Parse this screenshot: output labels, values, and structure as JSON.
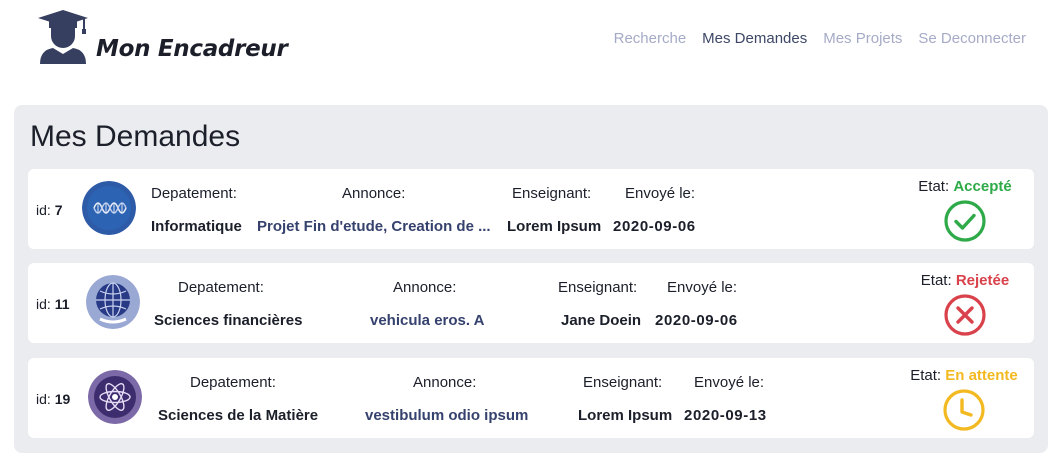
{
  "brand": {
    "name": "Mon Encadreur",
    "icon": "graduate-icon"
  },
  "nav": {
    "items": [
      {
        "label": "Recherche",
        "active": false
      },
      {
        "label": "Mes Demandes",
        "active": true
      },
      {
        "label": "Mes Projets",
        "active": false
      },
      {
        "label": "Se Deconnecter",
        "active": false
      }
    ]
  },
  "page": {
    "title": "Mes Demandes"
  },
  "labels": {
    "id": "id:",
    "departement": "Depatement:",
    "annonce": "Annonce:",
    "enseignant": "Enseignant:",
    "envoye": "Envoyé le:",
    "etat": "Etat:"
  },
  "colors": {
    "accepted": "#2eaa48",
    "rejected": "#d9414b",
    "pending": "#f3b921",
    "link": "#36426e"
  },
  "requests": [
    {
      "id": "7",
      "avatar": "dna-wave-icon",
      "departement": "Informatique",
      "annonce": "Projet Fin d'etude, Creation de ...",
      "enseignant": "Lorem Ipsum",
      "date": "2020-09-06",
      "status": "Accepté",
      "status_icon": "check-circle-icon"
    },
    {
      "id": "11",
      "avatar": "globe-icon",
      "departement": "Sciences financières",
      "annonce": "vehicula eros. A",
      "enseignant": "Jane Doein",
      "date": "2020-09-06",
      "status": "Rejetée",
      "status_icon": "x-circle-icon"
    },
    {
      "id": "19",
      "avatar": "atom-icon",
      "departement": "Sciences de la Matière",
      "annonce": "vestibulum odio ipsum",
      "enseignant": "Lorem Ipsum",
      "date": "2020-09-13",
      "status": "En attente",
      "status_icon": "clock-icon"
    }
  ]
}
